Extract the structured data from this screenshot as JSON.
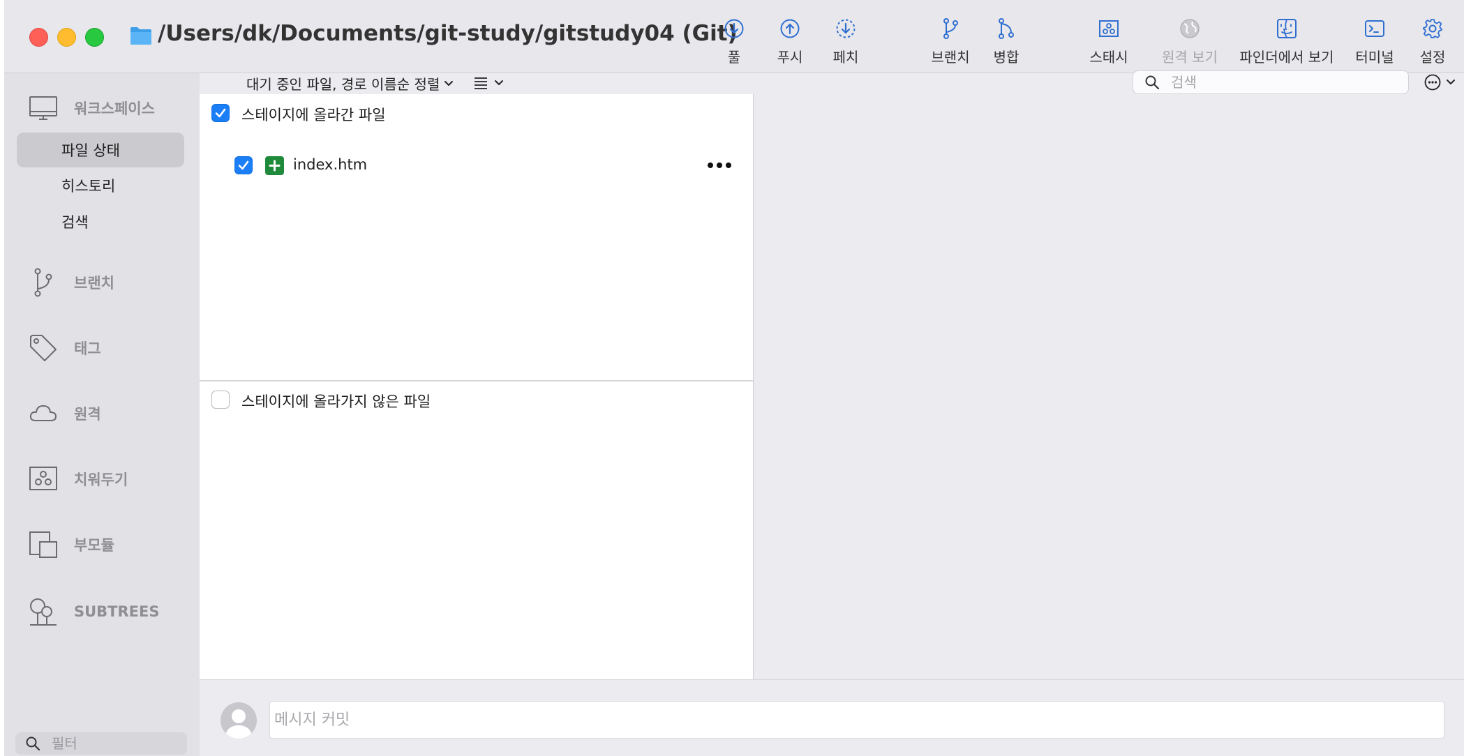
{
  "window": {
    "title": "/Users/dk/Documents/git-study/gitstudy04 (Git)"
  },
  "toolbar": {
    "pull": "풀",
    "push": "푸시",
    "fetch": "페치",
    "branch": "브랜치",
    "merge": "병합",
    "stash": "스태시",
    "remote_view": "원격 보기",
    "finder_view": "파인더에서 보기",
    "terminal": "터미널",
    "settings": "설정"
  },
  "sidebar": {
    "workspace": "워크스페이스",
    "workspace_items": [
      "파일 상태",
      "히스토리",
      "검색"
    ],
    "selected_item": "파일 상태",
    "sections": {
      "branches": "브랜치",
      "tags": "태그",
      "remotes": "원격",
      "stashes": "치워두기",
      "submodules": "부모듈",
      "subtrees": "SUBTREES"
    },
    "filter_placeholder": "필터"
  },
  "file_status": {
    "sort_label": "대기 중인 파일, 경로 이름순 정렬",
    "search_placeholder": "검색",
    "staged_label": "스테이지에 올라간 파일",
    "staged_checked": true,
    "staged_files": [
      {
        "name": "index.htm",
        "status": "added",
        "checked": true
      }
    ],
    "unstaged_label": "스테이지에 올라가지 않은 파일",
    "unstaged_checked": false
  },
  "commit": {
    "placeholder": "메시지 커밋"
  },
  "colors": {
    "accent": "#1a7ef6",
    "added": "#1f8a3a",
    "toolbar_icon": "#2f6fd1",
    "close": "#fe5f57",
    "minimize": "#febc2e",
    "maximize": "#28c840"
  }
}
